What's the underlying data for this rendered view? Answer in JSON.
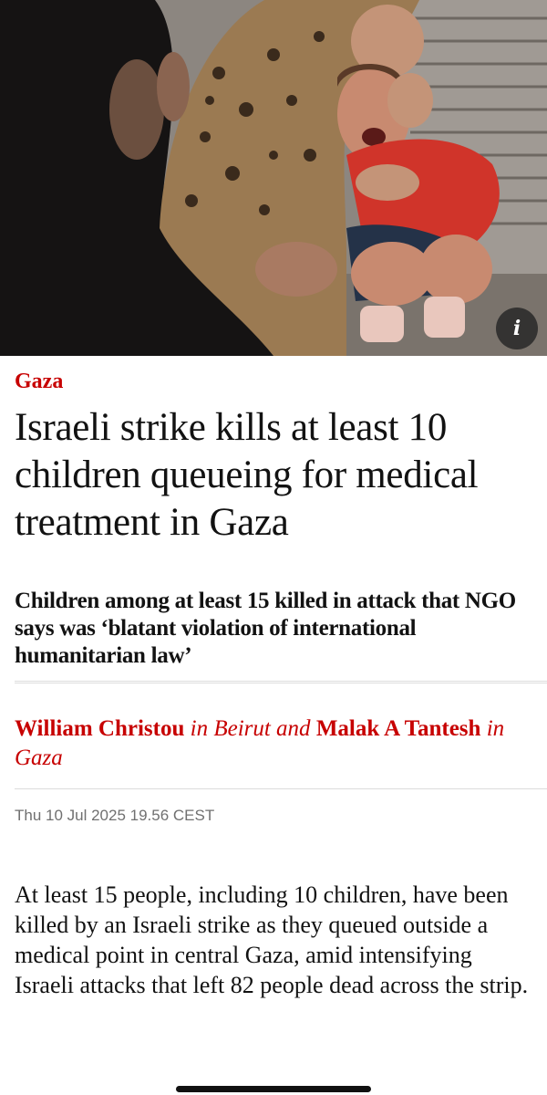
{
  "image": {
    "alt": "",
    "info_button_label": "i"
  },
  "article": {
    "section": "Gaza",
    "headline": "Israeli strike kills at least 10 children queueing for medical treatment in Gaza",
    "standfirst": "Children among at least 15 killed in attack that NGO says was ‘blatant violation of international humanitarian law’",
    "byline": {
      "author1": "William Christou",
      "location1": "in Beirut and",
      "author2": "Malak A Tantesh",
      "location2": "in Gaza"
    },
    "dateline": "Thu 10 Jul 2025 19.56 CEST",
    "body": "At least 15 people, including 10 children, have been killed by an Israeli strike as they queued outside a medical point in central Gaza, amid intensifying Israeli attacks that left 82 people dead across the strip."
  },
  "colors": {
    "accent": "#c70000",
    "text": "#121212",
    "muted": "#707070"
  }
}
